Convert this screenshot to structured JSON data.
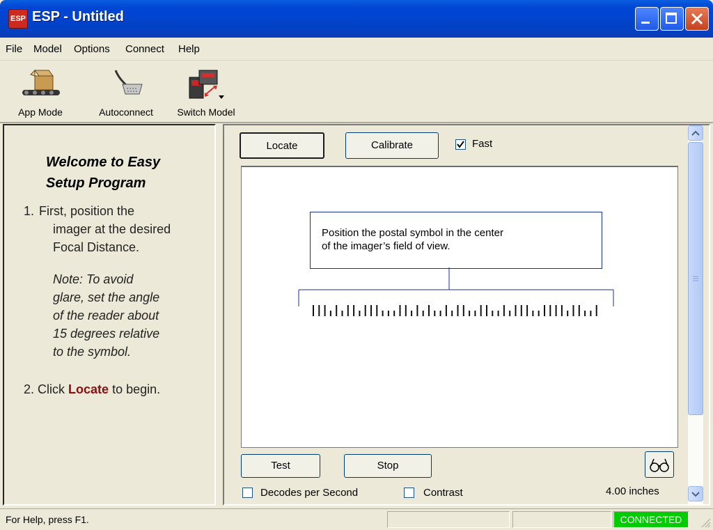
{
  "window": {
    "app_icon_text": "ESP",
    "title": "ESP - Untitled"
  },
  "menu": {
    "items": [
      "File",
      "Model",
      "Options",
      "Connect",
      "Help"
    ]
  },
  "toolbar": {
    "app_mode": "App Mode",
    "autoconnect": "Autoconnect",
    "switch_model": "Switch Model"
  },
  "left_panel": {
    "heading_line1": "Welcome to Easy",
    "heading_line2": "Setup Program",
    "step1_num": "1.",
    "step1_line1": "First, position the",
    "step1_line2": "imager at the desired",
    "step1_line3": "Focal Distance.",
    "note_line1": "Note: To avoid",
    "note_line2": "glare, set the angle",
    "note_line3": "of the reader about",
    "note_line4": "15 degrees relative",
    "note_line5": "to the symbol.",
    "step2_num": "2.",
    "step2_prefix": "Click",
    "step2_action": "Locate",
    "step2_suffix": "to begin."
  },
  "controls": {
    "locate": "Locate",
    "calibrate": "Calibrate",
    "fast_label": "Fast",
    "fast_checked": true,
    "test": "Test",
    "stop": "Stop",
    "decodes_label": "Decodes per Second",
    "decodes_checked": false,
    "contrast_label": "Contrast",
    "contrast_checked": false,
    "distance": "4.00 inches"
  },
  "viewer": {
    "instruction_line1": "Position the postal symbol in the center",
    "instruction_line2": "of the imager’s field of view."
  },
  "status": {
    "help_text": "For Help, press F1.",
    "connection": "CONNECTED",
    "connection_color": "#00cc00"
  }
}
